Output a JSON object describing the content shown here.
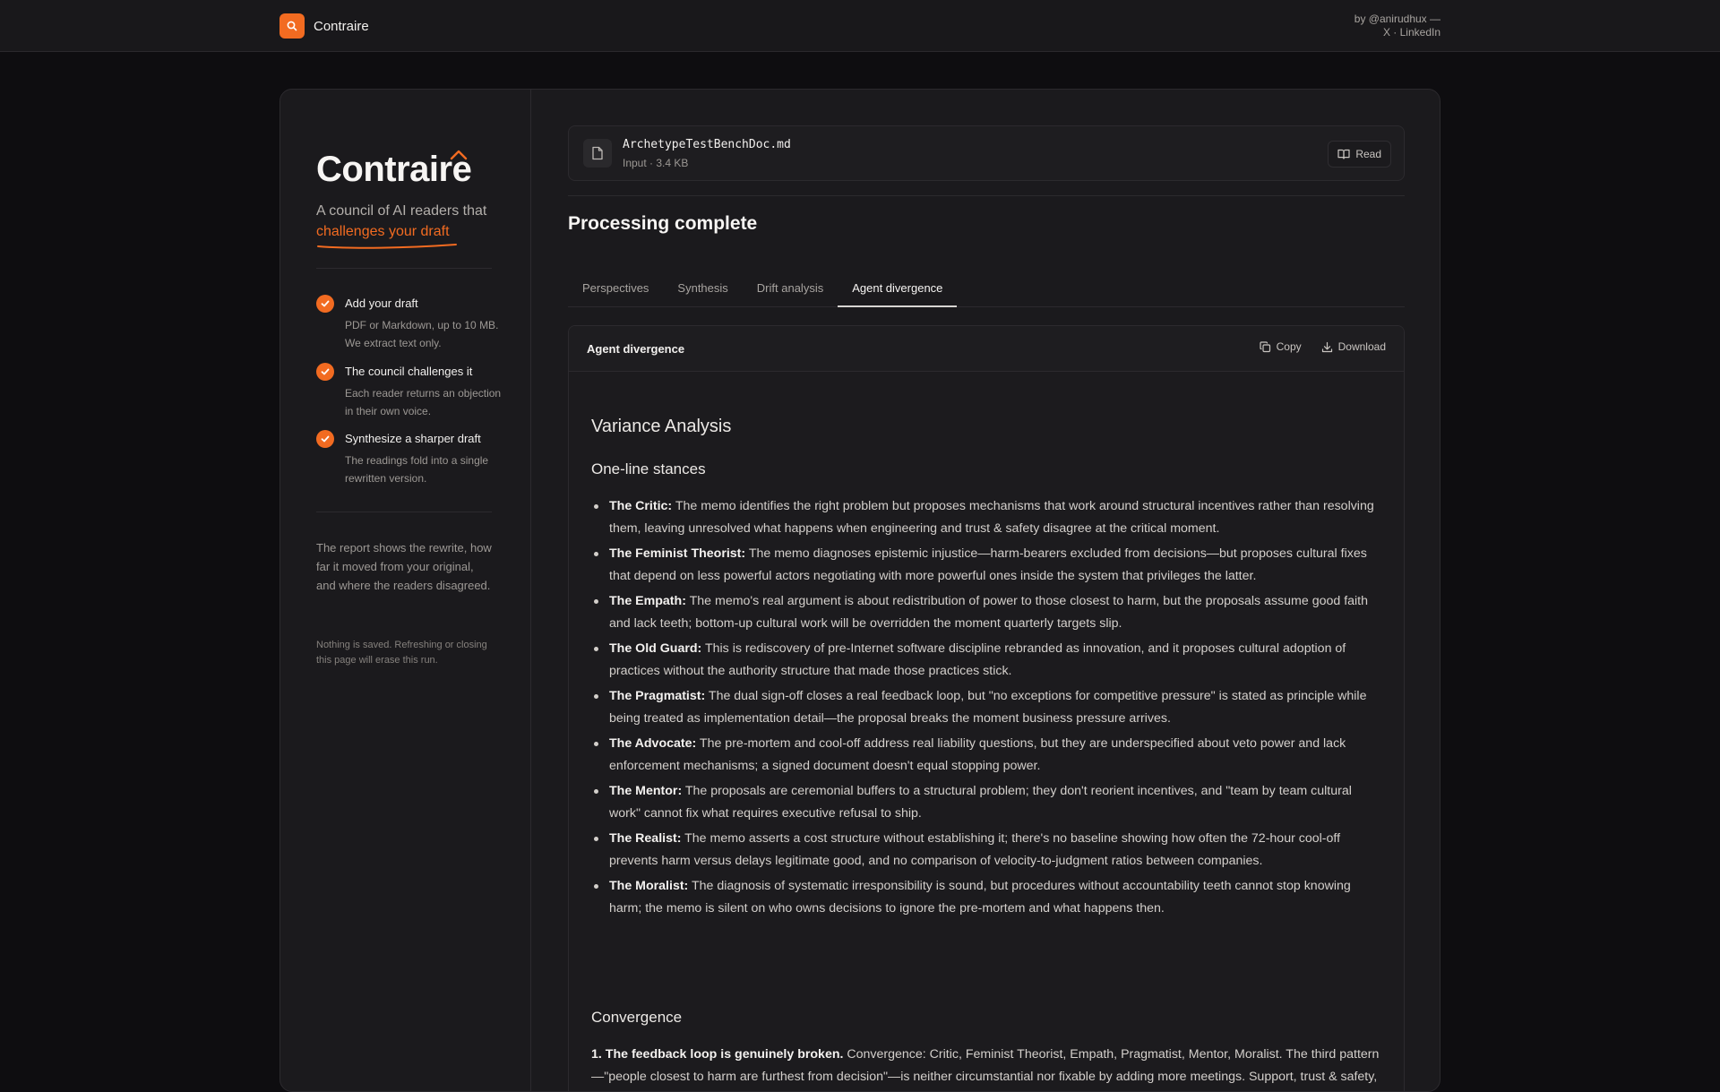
{
  "topbar": {
    "brand": "Contraire",
    "byline_prefix": "by @anirudhux —",
    "link_x": "X",
    "link_sep": " · ",
    "link_linkedin": "LinkedIn"
  },
  "sidebar": {
    "title": "Contraire",
    "tagline_plain": "A council of AI readers that",
    "tagline_highlight": "challenges your draft",
    "steps": [
      {
        "title": "Add your draft",
        "desc": "PDF or Markdown, up to 10 MB. We extract text only."
      },
      {
        "title": "The council challenges it",
        "desc": "Each reader returns an objection in their own voice."
      },
      {
        "title": "Synthesize a sharper draft",
        "desc": "The readings fold into a single rewritten version."
      }
    ],
    "note": "The report shows the rewrite, how far it moved from your original, and where the readers disagreed.",
    "fine_print": "Nothing is saved. Refreshing or closing this page will erase this run."
  },
  "file": {
    "name": "ArchetypeTestBenchDoc.md",
    "meta": "Input · 3.4 KB",
    "read_label": "Read"
  },
  "status_title": "Processing complete",
  "tabs": [
    "Perspectives",
    "Synthesis",
    "Drift analysis",
    "Agent divergence"
  ],
  "active_tab": "Agent divergence",
  "panel": {
    "title": "Agent divergence",
    "copy_label": "Copy",
    "download_label": "Download"
  },
  "doc": {
    "h_main": "Variance Analysis",
    "h_stances": "One-line stances",
    "stances": [
      {
        "name": "The Critic:",
        "text": " The memo identifies the right problem but proposes mechanisms that work around structural incentives rather than resolving them, leaving unresolved what happens when engineering and trust & safety disagree at the critical moment."
      },
      {
        "name": "The Feminist Theorist:",
        "text": " The memo diagnoses epistemic injustice—harm-bearers excluded from decisions—but proposes cultural fixes that depend on less powerful actors negotiating with more powerful ones inside the system that privileges the latter."
      },
      {
        "name": "The Empath:",
        "text": " The memo's real argument is about redistribution of power to those closest to harm, but the proposals assume good faith and lack teeth; bottom-up cultural work will be overridden the moment quarterly targets slip."
      },
      {
        "name": "The Old Guard:",
        "text": " This is rediscovery of pre-Internet software discipline rebranded as innovation, and it proposes cultural adoption of practices without the authority structure that made those practices stick."
      },
      {
        "name": "The Pragmatist:",
        "text": " The dual sign-off closes a real feedback loop, but \"no exceptions for competitive pressure\" is stated as principle while being treated as implementation detail—the proposal breaks the moment business pressure arrives."
      },
      {
        "name": "The Advocate:",
        "text": " The pre-mortem and cool-off address real liability questions, but they are underspecified about veto power and lack enforcement mechanisms; a signed document doesn't equal stopping power."
      },
      {
        "name": "The Mentor:",
        "text": " The proposals are ceremonial buffers to a structural problem; they don't reorient incentives, and \"team by team cultural work\" cannot fix what requires executive refusal to ship."
      },
      {
        "name": "The Realist:",
        "text": " The memo asserts a cost structure without establishing it; there's no baseline showing how often the 72-hour cool-off prevents harm versus delays legitimate good, and no comparison of velocity-to-judgment ratios between companies."
      },
      {
        "name": "The Moralist:",
        "text": " The diagnosis of systematic irresponsibility is sound, but procedures without accountability teeth cannot stop knowing harm; the memo is silent on who owns decisions to ignore the pre-mortem and what happens then."
      }
    ],
    "h_convergence": "Convergence",
    "convergence_lead": "1. The feedback loop is genuinely broken.",
    "convergence_text": " Convergence: Critic, Feminist Theorist, Empath, Pragmatist, Mentor, Moralist. The third pattern—\"people closest to harm are furthest from decision\"—is neither circumstantial nor fixable by adding more meetings. Support, trust & safety, and community teams see consequences; product and engineering decide. This is structural, not a communication problem. All six agents treated this as the legitimate core of the memo, though they disagreed on whether the"
  }
}
